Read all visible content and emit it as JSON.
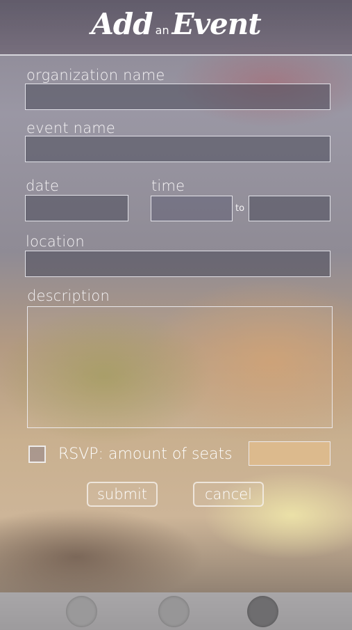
{
  "header": {
    "title_word1": "Add",
    "title_connector": "an",
    "title_word2": "Event"
  },
  "form": {
    "organization_label": "organization name",
    "organization_value": "",
    "event_label": "event name",
    "event_value": "",
    "date_label": "date",
    "date_value": "",
    "time_label": "time",
    "time_start_value": "",
    "time_separator": "to",
    "time_end_value": "",
    "location_label": "location",
    "location_value": "",
    "description_label": "description",
    "description_value": "",
    "rsvp_label": "RSVP: amount of seats",
    "rsvp_checked": false,
    "seats_value": ""
  },
  "buttons": {
    "submit_label": "submit",
    "cancel_label": "cancel"
  },
  "tabbar": {
    "tabs": [
      {
        "icon": "circle-tab-icon",
        "color": "#9a999a"
      },
      {
        "icon": "circle-tab-icon",
        "color": "#979697"
      },
      {
        "icon": "circle-tab-icon",
        "color": "#6e6d6f"
      }
    ]
  }
}
